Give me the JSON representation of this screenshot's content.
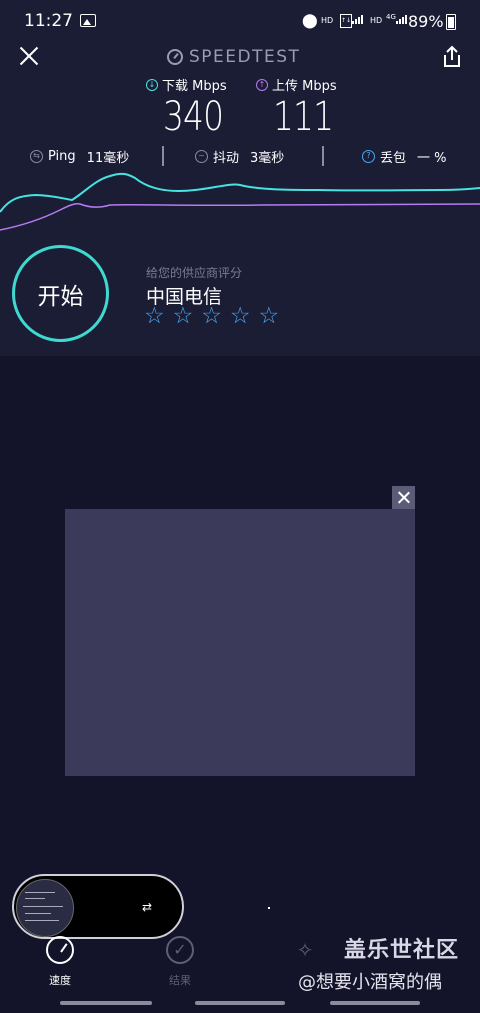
{
  "status_bar": {
    "time": "11:27",
    "net_label_1": "HD",
    "net_label_2": "4G",
    "net_label_3": "HD",
    "battery": "89%"
  },
  "header": {
    "app_title": "SPEEDTEST"
  },
  "metrics": {
    "download_label": "下载 Mbps",
    "download_value": "340",
    "upload_label": "上传 Mbps",
    "upload_value": "111"
  },
  "stats": {
    "ping_label": "Ping",
    "ping_value": "11毫秒",
    "jitter_label": "抖动",
    "jitter_value": "3毫秒",
    "loss_label": "丢包",
    "loss_value": "一 %"
  },
  "graph": {
    "download_color": "#46e3e0",
    "upload_color": "#b57bf1"
  },
  "start": {
    "label": "开始"
  },
  "provider": {
    "prompt": "给您的供应商评分",
    "name": "中国电信",
    "rating": 0,
    "max_rating": 5
  },
  "nav": {
    "tabs": [
      {
        "label": "速度",
        "icon": "gauge-icon",
        "active": true
      },
      {
        "label": "结果",
        "icon": "check-circle-icon",
        "active": false
      },
      {
        "label": "",
        "icon": "wand-icon",
        "active": false
      }
    ]
  },
  "watermark": {
    "brand": "盖乐世社区",
    "user": "@想要小酒窝的偶"
  },
  "colors": {
    "background": "#131429",
    "panel": "#1b1d35",
    "accent_teal": "#3fd9cf",
    "accent_blue": "#4aa8f0"
  }
}
